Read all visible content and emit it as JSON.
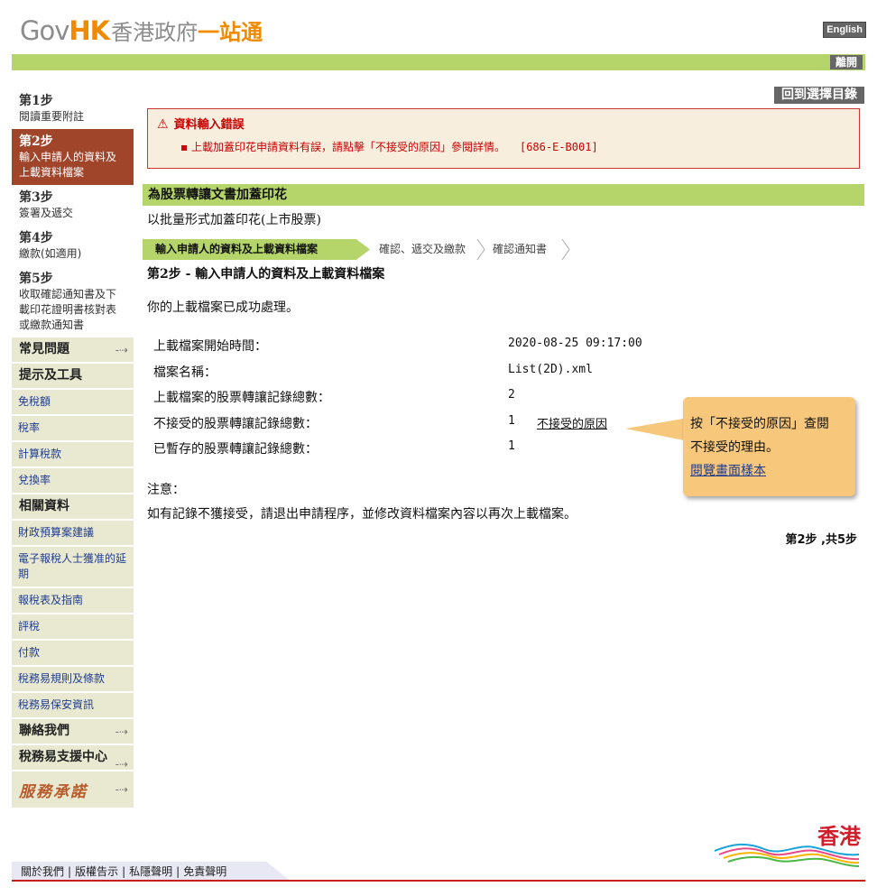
{
  "header": {
    "logo_gov": "Gov",
    "logo_hk": "HK",
    "logo_cn1": "香港政府",
    "logo_cn2": "一站通",
    "english_label": "English",
    "logout_label": "離開",
    "back_label": "回到選擇目錄"
  },
  "sidebar": {
    "steps": [
      {
        "num": "第1步",
        "text": "閱讀重要附註"
      },
      {
        "num": "第2步",
        "text": "輸入申請人的資料及上載資料檔案"
      },
      {
        "num": "第3步",
        "text": "簽署及遞交"
      },
      {
        "num": "第4步",
        "text": "繳款(如適用)"
      },
      {
        "num": "第5步",
        "text": "收取確認通知書及下載印花證明書核對表或繳款通知書"
      }
    ],
    "faq": "常見問題",
    "tools": "提示及工具",
    "tool_links": [
      "免稅額",
      "稅率",
      "計算稅款",
      "兌換率"
    ],
    "related": "相關資料",
    "related_links": [
      "財政預算案建議",
      "電子報稅人士獲准的延期",
      "報稅表及指南",
      "評稅",
      "付款",
      "稅務易規則及條款",
      "稅務易保安資訊"
    ],
    "contact": "聯絡我們",
    "support": "稅務易支援中心",
    "brand": "服務承諾"
  },
  "error": {
    "title": "資料輸入錯誤",
    "message": "上載加蓋印花申請資料有誤，請點擊「不接受的原因」參閱詳情。",
    "code": "[686-E-B001]"
  },
  "main": {
    "section_title": "為股票轉讓文書加蓋印花",
    "subtitle": "以批量形式加蓋印花(上市股票)",
    "progress": [
      "輸入申請人的資料及上載資料檔案",
      "確認、遞交及繳款",
      "確認通知書"
    ],
    "step_title": "第2步 - 輸入申請人的資料及上載資料檔案",
    "success": "你的上載檔案已成功處理。",
    "details": [
      {
        "label": "上載檔案開始時間：",
        "value": "2020-08-25 09:17:00"
      },
      {
        "label": "檔案名稱：",
        "value": "List(2D).xml"
      },
      {
        "label": "上載檔案的股票轉讓記錄總數：",
        "value": "2"
      },
      {
        "label": "不接受的股票轉讓記錄總數：",
        "value": "1",
        "link": "不接受的原因"
      },
      {
        "label": "已暫存的股票轉讓記錄總數：",
        "value": "1"
      }
    ],
    "tooltip_line1": "按「不接受的原因」查閱",
    "tooltip_line2": "不接受的理由。",
    "tooltip_link": "閱覽畫面樣本",
    "note_label": "注意：",
    "note_text": "如有記錄不獲接受，請退出申請程序，並修改資料檔案內容以再次上載檔案。",
    "step_count": "第2步 ,共5步"
  },
  "footer": {
    "links": [
      "關於我們",
      "版權告示",
      "私隱聲明",
      "免責聲明"
    ],
    "brand": "香港"
  },
  "colors": {
    "green_bar": "#b5d56b",
    "active_step": "#a0442a",
    "error_red": "#cc0000",
    "sidebar_bg": "#e9e9d2"
  }
}
